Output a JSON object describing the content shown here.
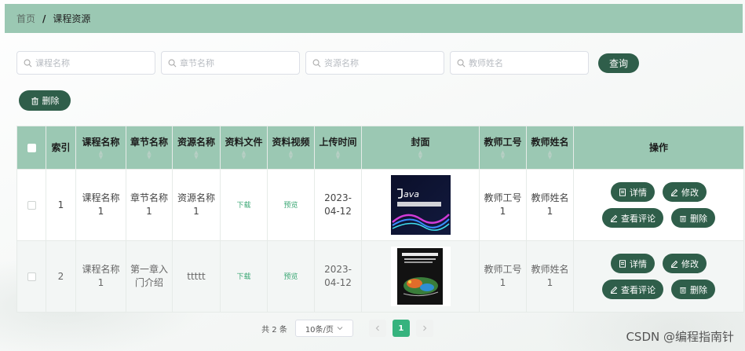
{
  "breadcrumb": {
    "home": "首页",
    "separator": "/",
    "current": "课程资源"
  },
  "search": {
    "course_placeholder": "课程名称",
    "chapter_placeholder": "章节名称",
    "resource_placeholder": "资源名称",
    "teacher_placeholder": "教师姓名",
    "query_label": "查询"
  },
  "toolbar": {
    "delete_label": "删除"
  },
  "table": {
    "headers": {
      "index": "索引",
      "course": "课程名称",
      "chapter": "章节名称",
      "resource": "资源名称",
      "material_file": "资料文件",
      "material_video": "资料视频",
      "upload_time": "上传时间",
      "cover": "封面",
      "teacher_no": "教师工号",
      "teacher_name": "教师姓名",
      "actions": "操作"
    },
    "rows": [
      {
        "index": "1",
        "course": "课程名称1",
        "chapter": "章节名称1",
        "resource": "资源名称1",
        "file": "下载",
        "video": "预览",
        "time": "2023-04-12",
        "teacher_no": "教师工号1",
        "teacher_name": "教师姓名1"
      },
      {
        "index": "2",
        "course": "课程名称1",
        "chapter": "第一章入门介绍",
        "resource": "ttttt",
        "file": "下载",
        "video": "预览",
        "time": "2023-04-12",
        "teacher_no": "教师工号1",
        "teacher_name": "教师姓名1"
      }
    ],
    "actions": {
      "detail": "详情",
      "edit": "修改",
      "comments": "查看评论",
      "delete": "删除"
    }
  },
  "pagination": {
    "total": "共 2 条",
    "page_size": "10条/页",
    "current_page": "1"
  },
  "watermark": "CSDN @编程指南针",
  "colors": {
    "header_bg": "#9bc8b3",
    "button_bg": "#2f5e4a",
    "active_page": "#36b37e",
    "link": "#3aa774"
  },
  "icons": [
    "search-icon",
    "trash-icon",
    "document-icon",
    "pencil-icon",
    "chevron-left-icon",
    "chevron-right-icon",
    "chevron-down-icon"
  ]
}
